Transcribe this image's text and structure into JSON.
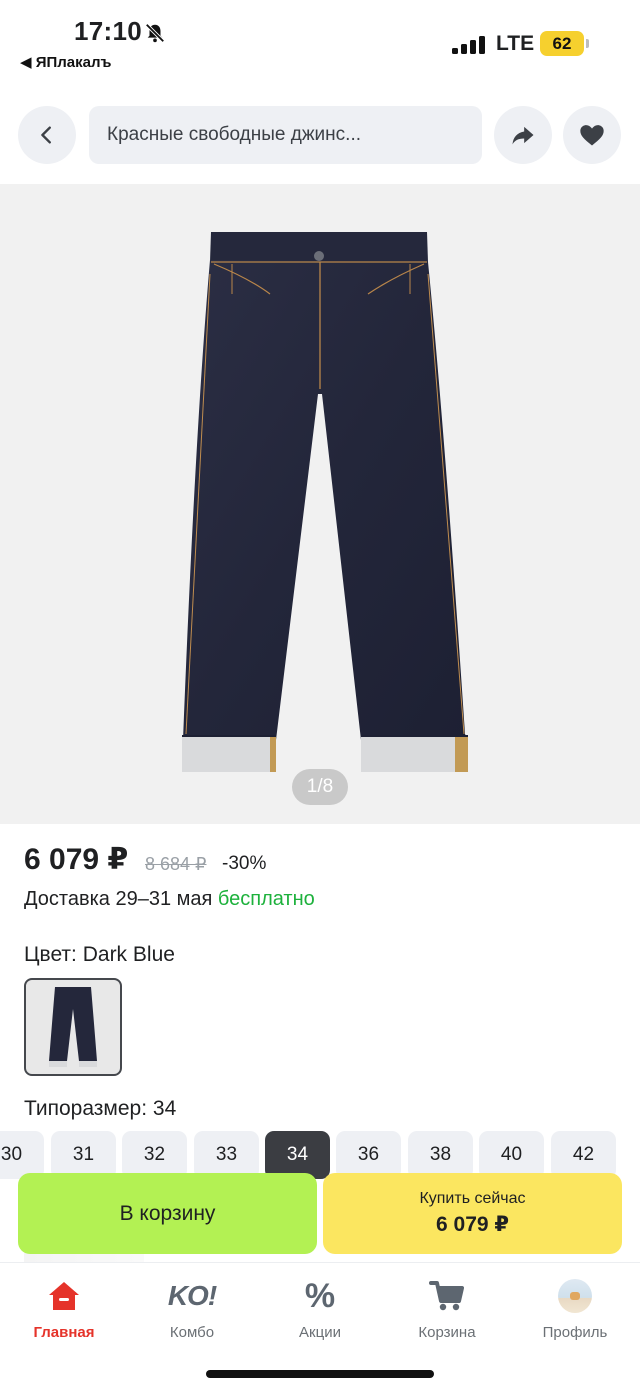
{
  "status": {
    "time": "17:10",
    "back_app": "◀ ЯПлакалъ",
    "network": "LTE",
    "battery": "62"
  },
  "topbar": {
    "search_text": "Красные свободные джинс..."
  },
  "gallery": {
    "pager": "1/8"
  },
  "product": {
    "price": "6 079 ₽",
    "old_price": "8 684 ₽",
    "discount": "-30%",
    "delivery_prefix": "Доставка 29–31 мая",
    "delivery_free": "бесплатно",
    "color_label": "Цвет: Dark Blue",
    "size_label": "Типоразмер: 34",
    "sizes": [
      "30",
      "31",
      "32",
      "33",
      "34",
      "36",
      "38",
      "40",
      "42"
    ],
    "selected_size": "34"
  },
  "actions": {
    "add_to_cart": "В корзину",
    "buy_now": "Купить сейчас",
    "buy_now_price": "6 079 ₽"
  },
  "tabbar": {
    "items": [
      {
        "label": "Главная",
        "icon": "home-icon"
      },
      {
        "label": "Комбо",
        "icon": "ko-combo-icon",
        "glyph": "KO!"
      },
      {
        "label": "Акции",
        "icon": "percent-icon",
        "glyph": "%"
      },
      {
        "label": "Корзина",
        "icon": "cart-icon"
      },
      {
        "label": "Профиль",
        "icon": "avatar-icon"
      }
    ],
    "active": "Главная"
  },
  "colors": {
    "accent_red": "#e5332a",
    "cart_green": "#b3f153",
    "buy_yellow": "#fbe660",
    "free_green": "#1db13c",
    "battery_yellow": "#f6d02e"
  }
}
